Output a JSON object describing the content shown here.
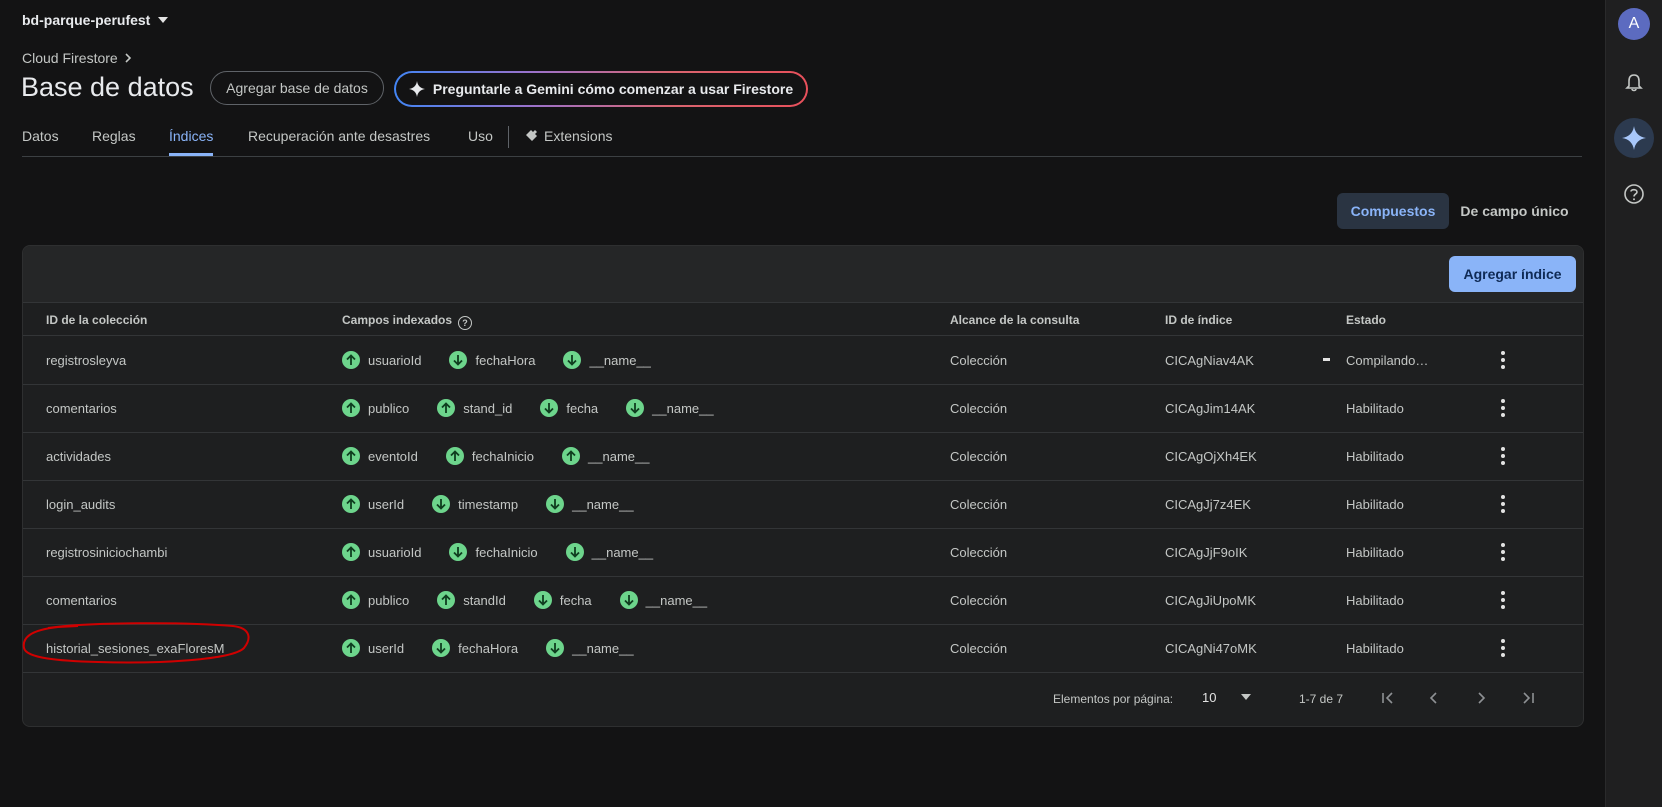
{
  "project": {
    "name": "bd-parque-perufest"
  },
  "breadcrumb": {
    "label": "Cloud Firestore"
  },
  "header": {
    "title": "Base de datos",
    "add_db_label": "Agregar base de datos",
    "gemini_label": "Preguntarle a Gemini cómo comenzar a usar Firestore"
  },
  "tabs": [
    {
      "label": "Datos"
    },
    {
      "label": "Reglas"
    },
    {
      "label": "Índices",
      "active": true
    },
    {
      "label": "Recuperación ante desastres"
    },
    {
      "label": "Uso"
    },
    {
      "label": "Extensions"
    }
  ],
  "segmented": {
    "composite": "Compuestos",
    "single": "De campo único"
  },
  "table": {
    "add_index_label": "Agregar índice",
    "columns": [
      "ID de la colección",
      "Campos indexados",
      "Alcance de la consulta",
      "ID de índice",
      "Estado"
    ],
    "rows": [
      {
        "collection": "registrosleyva",
        "fields": [
          {
            "name": "usuarioId",
            "dir": "up"
          },
          {
            "name": "fechaHora",
            "dir": "down"
          },
          {
            "name": "__name__",
            "dir": "down"
          }
        ],
        "scope": "Colección",
        "index_id": "CICAgNiav4AK",
        "status": "Compilando…",
        "building": true
      },
      {
        "collection": "comentarios",
        "fields": [
          {
            "name": "publico",
            "dir": "up"
          },
          {
            "name": "stand_id",
            "dir": "up"
          },
          {
            "name": "fecha",
            "dir": "down"
          },
          {
            "name": "__name__",
            "dir": "down"
          }
        ],
        "scope": "Colección",
        "index_id": "CICAgJim14AK",
        "status": "Habilitado"
      },
      {
        "collection": "actividades",
        "fields": [
          {
            "name": "eventoId",
            "dir": "up"
          },
          {
            "name": "fechaInicio",
            "dir": "up"
          },
          {
            "name": "__name__",
            "dir": "up"
          }
        ],
        "scope": "Colección",
        "index_id": "CICAgOjXh4EK",
        "status": "Habilitado"
      },
      {
        "collection": "login_audits",
        "fields": [
          {
            "name": "userId",
            "dir": "up"
          },
          {
            "name": "timestamp",
            "dir": "down"
          },
          {
            "name": "__name__",
            "dir": "down"
          }
        ],
        "scope": "Colección",
        "index_id": "CICAgJj7z4EK",
        "status": "Habilitado"
      },
      {
        "collection": "registrosiniciochambi",
        "fields": [
          {
            "name": "usuarioId",
            "dir": "up"
          },
          {
            "name": "fechaInicio",
            "dir": "down"
          },
          {
            "name": "__name__",
            "dir": "down"
          }
        ],
        "scope": "Colección",
        "index_id": "CICAgJjF9oIK",
        "status": "Habilitado"
      },
      {
        "collection": "comentarios",
        "fields": [
          {
            "name": "publico",
            "dir": "up"
          },
          {
            "name": "standId",
            "dir": "up"
          },
          {
            "name": "fecha",
            "dir": "down"
          },
          {
            "name": "__name__",
            "dir": "down"
          }
        ],
        "scope": "Colección",
        "index_id": "CICAgJiUpoMK",
        "status": "Habilitado"
      },
      {
        "collection": "historial_sesiones_exaFloresM",
        "fields": [
          {
            "name": "userId",
            "dir": "up"
          },
          {
            "name": "fechaHora",
            "dir": "down"
          },
          {
            "name": "__name__",
            "dir": "down"
          }
        ],
        "scope": "Colección",
        "index_id": "CICAgNi47oMK",
        "status": "Habilitado",
        "highlighted": true
      }
    ]
  },
  "pagination": {
    "per_page_label": "Elementos por página:",
    "per_page": "10",
    "range": "1-7 de 7"
  },
  "rail": {
    "avatar_letter": "A"
  },
  "colors": {
    "accent": "#8ab4f8",
    "field_icon": "#6dd58c",
    "annotation": "#d00000"
  }
}
